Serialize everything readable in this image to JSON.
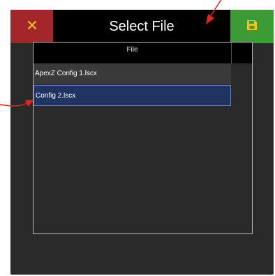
{
  "dialog": {
    "title": "Select File",
    "close_icon": "close-icon",
    "save_icon": "save-icon",
    "accent_close": "#a3262b",
    "accent_save": "#3d9b36"
  },
  "table": {
    "column_header": "File",
    "rows": [
      {
        "name": "ApexZ Config 1.lscx",
        "selected": false
      },
      {
        "name": "Config 2.lscx",
        "selected": true
      }
    ],
    "selection_color": "#1f3461"
  },
  "annotations": {
    "arrow_color": "#e8251c"
  }
}
